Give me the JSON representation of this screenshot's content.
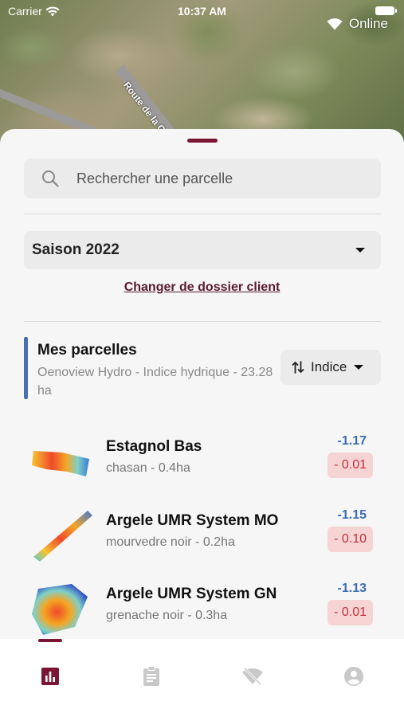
{
  "status_bar": {
    "carrier": "Carrier",
    "time": "10:37 AM"
  },
  "connection": {
    "status": "Online",
    "icon": "wifi-icon"
  },
  "map": {
    "road_label": "Route de la G"
  },
  "search": {
    "placeholder": "Rechercher une parcelle"
  },
  "season": {
    "selected": "Saison 2022"
  },
  "client_link": "Changer de dossier client",
  "parcels": {
    "title": "Mes parcelles",
    "subtitle": "Oenoview Hydro - Indice hydrique - 23.28 ha",
    "sort_label": "Indice",
    "items": [
      {
        "name": "Estagnol Bas",
        "meta": "chasan - 0.4ha",
        "value": "-1.17",
        "delta": "- 0.01"
      },
      {
        "name": "Argele UMR System MO",
        "meta": "mourvedre noir - 0.2ha",
        "value": "-1.15",
        "delta": "- 0.10"
      },
      {
        "name": "Argele UMR System GN",
        "meta": "grenache noir - 0.3ha",
        "value": "-1.13",
        "delta": "- 0.01"
      }
    ]
  },
  "tabs": [
    {
      "icon": "bar-chart-icon",
      "active": true
    },
    {
      "icon": "clipboard-icon",
      "active": false
    },
    {
      "icon": "wifi-off-icon",
      "active": false
    },
    {
      "icon": "account-icon",
      "active": false
    }
  ],
  "colors": {
    "accent": "#7a1634",
    "index_value": "#3c6cb4",
    "delta_text": "#c0303a",
    "delta_bg": "#f7d4d4",
    "parcels_bar": "#4a6fb0"
  }
}
